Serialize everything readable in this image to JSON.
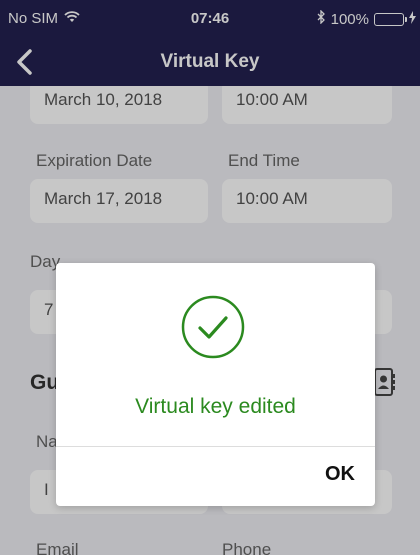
{
  "status_bar": {
    "carrier": "No SIM",
    "time": "07:46",
    "battery": "100%",
    "icons": [
      "wifi-icon",
      "bluetooth-icon",
      "battery-icon",
      "charging-icon"
    ]
  },
  "nav": {
    "title": "Virtual Key",
    "back_icon": "chevron-left-icon"
  },
  "form": {
    "start_date_value": "March 10, 2018",
    "start_time_value": "10:00 AM",
    "expiration_label": "Expiration Date",
    "end_time_label": "End Time",
    "expiration_value": "March 17, 2018",
    "end_time_value": "10:00 AM",
    "days_label_partial": "Day",
    "days_value_partial": "7",
    "guest_section_partial": "Gu",
    "name_label_partial": "Na",
    "name_value_partial": "I",
    "email_label": "Email",
    "phone_label": "Phone"
  },
  "dialog": {
    "message": "Virtual key edited",
    "ok_label": "OK",
    "icon": "checkmark-circle-icon"
  },
  "colors": {
    "header_bg": "#232150",
    "page_bg": "#efeff4",
    "success_green": "#2b8a1f",
    "battery_green": "#2ecc40"
  }
}
